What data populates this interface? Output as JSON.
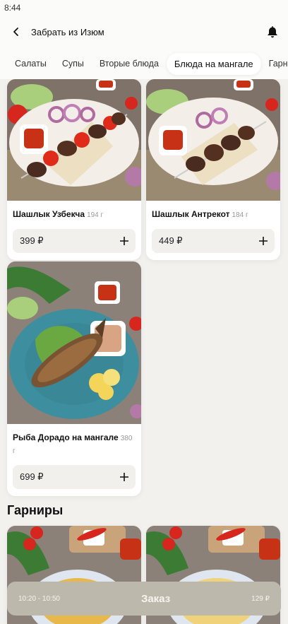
{
  "status": {
    "time": "8:44"
  },
  "header": {
    "title": "Забрать из Изюм"
  },
  "tabs": [
    {
      "label": "Салаты"
    },
    {
      "label": "Супы"
    },
    {
      "label": "Вторые блюда"
    },
    {
      "label": "Блюда на мангале",
      "active": true
    },
    {
      "label": "Гарниры"
    }
  ],
  "items": [
    {
      "title": "Шашлык Узбекча",
      "weight": "194 г",
      "price": "399 ₽"
    },
    {
      "title": "Шашлык Антрекот",
      "weight": "184 г",
      "price": "449 ₽"
    },
    {
      "title": "Рыба Дорадо на мангале",
      "weight": "380 г",
      "price": "699 ₽"
    }
  ],
  "section": {
    "garnish_title": "Гарниры"
  },
  "order": {
    "time_range": "10:20 - 10:50",
    "label": "Заказ",
    "total": "129 ₽"
  },
  "icons": {
    "back": "chevron-left-icon",
    "bell": "bell-icon",
    "add": "plus-icon"
  },
  "colors": {
    "background": "#f2f1ee",
    "card": "#ffffff",
    "price_chip": "#f1f0ed",
    "order_bar": "#bdb8ac",
    "plate_dark": "#3d8fa0"
  }
}
